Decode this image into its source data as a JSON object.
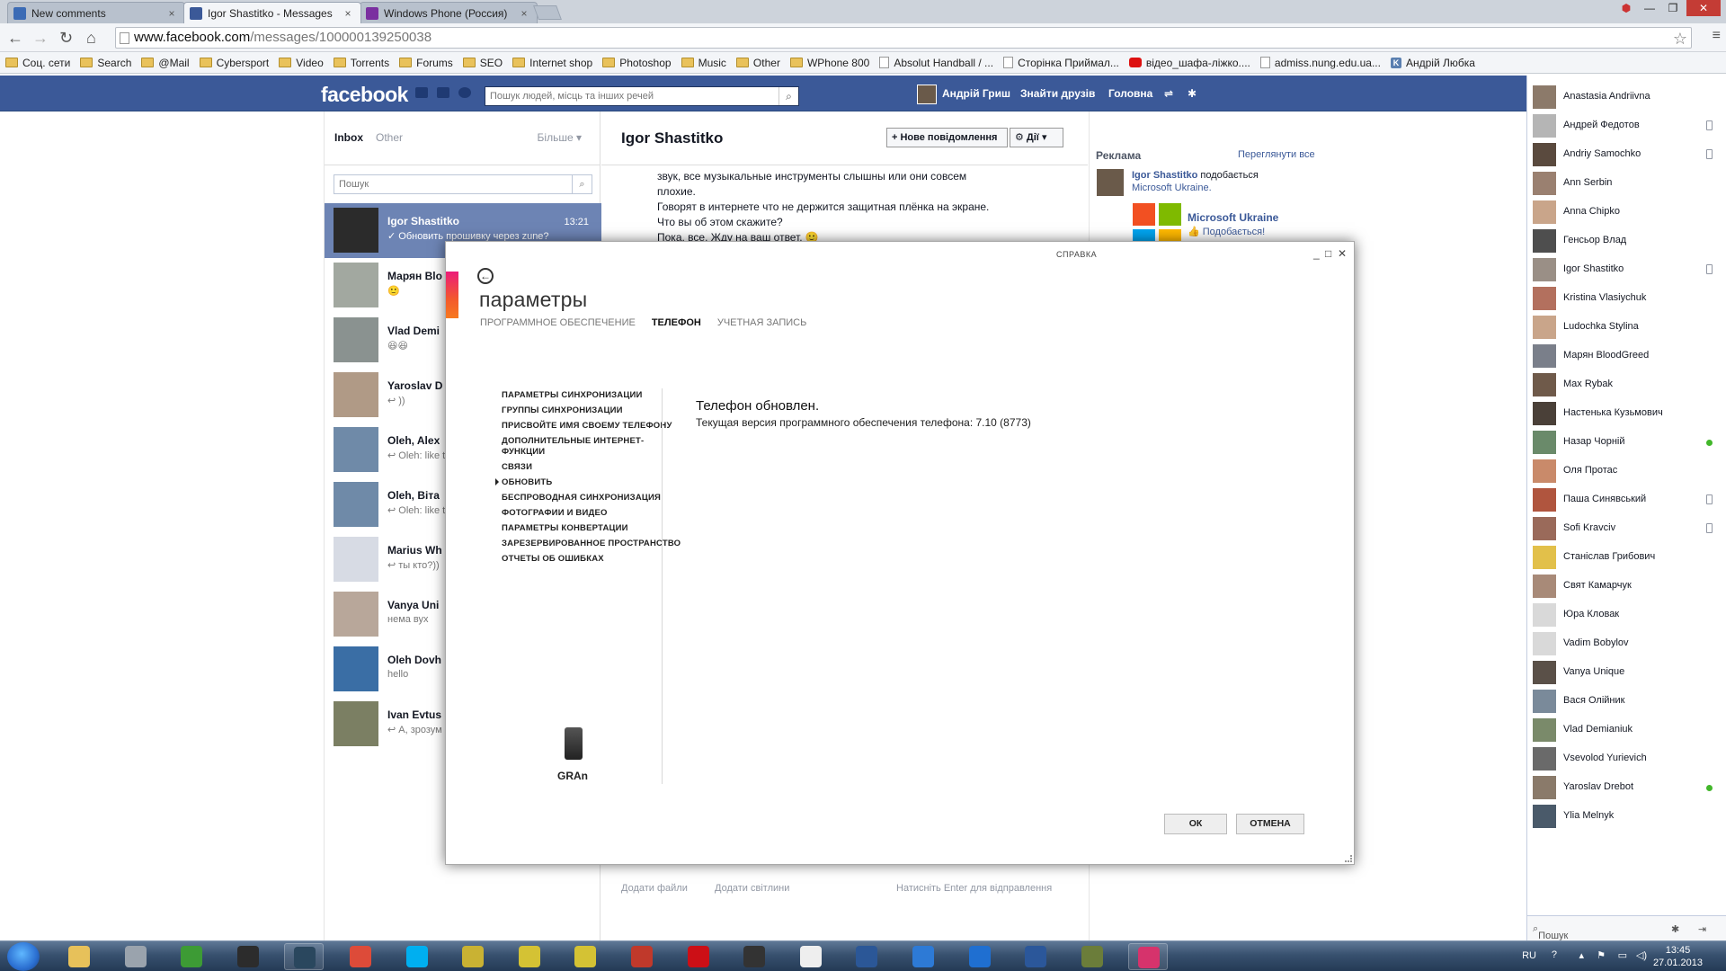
{
  "browser": {
    "tabs": [
      {
        "title": "New comments",
        "color": "#3b6bb5",
        "active": false
      },
      {
        "title": "Igor Shastitko - Messages",
        "color": "#3b5998",
        "active": true
      },
      {
        "title": "Windows Phone (Россия)",
        "color": "#7a2fa0",
        "active": false
      }
    ],
    "url_domain": "www.facebook.com",
    "url_path": "/messages/100000139250038",
    "bookmarks": [
      {
        "label": "Соц. сети",
        "type": "folder"
      },
      {
        "label": "Search",
        "type": "folder"
      },
      {
        "label": "@Mail",
        "type": "folder"
      },
      {
        "label": "Cybersport",
        "type": "folder"
      },
      {
        "label": "Video",
        "type": "folder"
      },
      {
        "label": "Torrents",
        "type": "folder"
      },
      {
        "label": "Forums",
        "type": "folder"
      },
      {
        "label": "SEO",
        "type": "folder"
      },
      {
        "label": "Internet shop",
        "type": "folder"
      },
      {
        "label": "Photoshop",
        "type": "folder"
      },
      {
        "label": "Music",
        "type": "folder"
      },
      {
        "label": "Other",
        "type": "folder"
      },
      {
        "label": "WPhone 800",
        "type": "folder"
      },
      {
        "label": "Absolut Handball / ...",
        "type": "page"
      },
      {
        "label": "Сторінка Приймал...",
        "type": "page"
      },
      {
        "label": "відео_шафа-ліжко....",
        "type": "youtube"
      },
      {
        "label": "admiss.nung.edu.ua...",
        "type": "page"
      },
      {
        "label": "Андрій Любка",
        "type": "k"
      }
    ]
  },
  "facebook": {
    "logo": "facebook",
    "search_placeholder": "Пошук людей, місць та інших речей",
    "user_name": "Андрій Гриш",
    "find_friends": "Знайти друзів",
    "home": "Головна",
    "inbox": {
      "title": "Inbox",
      "other": "Other",
      "more": "Більше ▾",
      "search_placeholder": "Пошук",
      "conversations": [
        {
          "name": "Igor Shastitko",
          "snippet": "✓ Обновить прошивку через zune?",
          "time": "13:21",
          "selected": true
        },
        {
          "name": "Марян Blo",
          "snippet": "🙂",
          "time": "",
          "selected": false
        },
        {
          "name": "Vlad Demi",
          "snippet": "😆😆",
          "time": "",
          "selected": false
        },
        {
          "name": "Yaroslav D",
          "snippet": "↩ ))",
          "time": "",
          "selected": false
        },
        {
          "name": "Oleh, Alex",
          "snippet": "↩ Oleh: like t",
          "time": "",
          "selected": false
        },
        {
          "name": "Oleh, Віта",
          "snippet": "↩ Oleh: like t",
          "time": "",
          "selected": false
        },
        {
          "name": "Marius Wh",
          "snippet": "↩ ты кто?))",
          "time": "",
          "selected": false
        },
        {
          "name": "Vanya Uni",
          "snippet": "нема вух",
          "time": "",
          "selected": false
        },
        {
          "name": "Oleh Dovh",
          "snippet": "hello",
          "time": "",
          "selected": false
        },
        {
          "name": "Ivan Evtus",
          "snippet": "↩ А, зрозум",
          "time": "",
          "selected": false
        }
      ]
    },
    "thread": {
      "name": "Igor Shastitko",
      "new_message": "+ Нове повідомлення",
      "actions": "⚙ Дії ▾",
      "messages": [
        "звук, все музыкальные инструменты слышны или они совсем",
        "плохие.",
        "Говорят в интернете что не держится защитная плёнка на экране.",
        "Что вы об этом скажите?",
        "Пока, все. Жду на ваш ответ. 🙂"
      ],
      "add_files": "Додати файли",
      "add_photos": "Додати світлини",
      "enter_hint": "Натисніть Enter для відправлення"
    },
    "ads": {
      "title": "Реклама",
      "see_all": "Переглянути все",
      "liker": "Igor Shastitko",
      "liker_text": "подобається",
      "liked_page": "Microsoft Ukraine.",
      "page_name": "Microsoft Ukraine",
      "like_label": "Подобається!"
    },
    "chat": {
      "friends": [
        {
          "name": "Anastasia Andriivna",
          "status": ""
        },
        {
          "name": "Андрей Федотов",
          "status": "mobile"
        },
        {
          "name": "Andriy Samochko",
          "status": "mobile"
        },
        {
          "name": "Ann Serbin",
          "status": ""
        },
        {
          "name": "Anna Chipko",
          "status": ""
        },
        {
          "name": "Генсьор Влад",
          "status": ""
        },
        {
          "name": "Igor Shastitko",
          "status": "mobile"
        },
        {
          "name": "Kristina Vlasiychuk",
          "status": ""
        },
        {
          "name": "Ludochka Stylina",
          "status": ""
        },
        {
          "name": "Марян BloodGreed",
          "status": ""
        },
        {
          "name": "Max Rybak",
          "status": ""
        },
        {
          "name": "Настенька Кузьмович",
          "status": ""
        },
        {
          "name": "Назар Чорній",
          "status": "online"
        },
        {
          "name": "Оля Протас",
          "status": ""
        },
        {
          "name": "Паша Синявський",
          "status": "mobile"
        },
        {
          "name": "Sofi Kravciv",
          "status": "mobile"
        },
        {
          "name": "Станіслав Грибович",
          "status": ""
        },
        {
          "name": "Свят Камарчук",
          "status": ""
        },
        {
          "name": "Юра Кловак",
          "status": ""
        },
        {
          "name": "Vadim Bobylov",
          "status": ""
        },
        {
          "name": "Vanya Unique",
          "status": ""
        },
        {
          "name": "Вася Олійник",
          "status": ""
        },
        {
          "name": "Vlad Demianiuk",
          "status": ""
        },
        {
          "name": "Vsevolod Yurievich",
          "status": ""
        },
        {
          "name": "Yaroslav Drebot",
          "status": "online"
        },
        {
          "name": "Ylia Melnyk",
          "status": ""
        }
      ],
      "search_placeholder": "Пошук"
    }
  },
  "zune": {
    "help": "СПРАВКА",
    "title": "параметры",
    "tabs": [
      {
        "label": "ПРОГРАММНОЕ ОБЕСПЕЧЕНИЕ",
        "active": false
      },
      {
        "label": "ТЕЛЕФОН",
        "active": true
      },
      {
        "label": "УЧЕТНАЯ ЗАПИСЬ",
        "active": false
      }
    ],
    "menu": [
      {
        "label": "ПАРАМЕТРЫ СИНХРОНИЗАЦИИ",
        "current": false
      },
      {
        "label": "ГРУППЫ СИНХРОНИЗАЦИИ",
        "current": false
      },
      {
        "label": "ПРИСВОЙТЕ ИМЯ СВОЕМУ ТЕЛЕФОНУ",
        "current": false
      },
      {
        "label": "ДОПОЛНИТЕЛЬНЫЕ ИНТЕРНЕТ-ФУНКЦИИ",
        "current": false
      },
      {
        "label": "СВЯЗИ",
        "current": false
      },
      {
        "label": "ОБНОВИТЬ",
        "current": true
      },
      {
        "label": "БЕСПРОВОДНАЯ СИНХРОНИЗАЦИЯ",
        "current": false
      },
      {
        "label": "ФОТОГРАФИИ И ВИДЕО",
        "current": false
      },
      {
        "label": "ПАРАМЕТРЫ КОНВЕРТАЦИИ",
        "current": false
      },
      {
        "label": "ЗАРЕЗЕРВИРОВАННОЕ ПРОСТРАНСТВО",
        "current": false
      },
      {
        "label": "ОТЧЕТЫ ОБ ОШИБКАХ",
        "current": false
      }
    ],
    "phone_name": "GRAn",
    "status": "Телефон обновлен.",
    "version_text": "Текущая версия программного обеспечения телефона: 7.10 (8773)",
    "ok": "ОК",
    "cancel": "ОТМЕНА"
  },
  "taskbar": {
    "apps": [
      {
        "icon": "explorer-icon",
        "color": "#e7c15a"
      },
      {
        "icon": "media-icon",
        "color": "#9aa3ad"
      },
      {
        "icon": "utorrent-icon",
        "color": "#3d9b35"
      },
      {
        "icon": "winamp-icon",
        "color": "#2c2c2c"
      },
      {
        "icon": "steam-icon",
        "color": "#2a475e"
      },
      {
        "icon": "chrome-icon",
        "color": "#dd4b39"
      },
      {
        "icon": "skype-icon",
        "color": "#00aff0"
      },
      {
        "icon": "game-icon",
        "color": "#c9b233"
      },
      {
        "icon": "totalcmd-icon",
        "color": "#d4c234"
      },
      {
        "icon": "totalcmd2-icon",
        "color": "#d4c234"
      },
      {
        "icon": "mobile-icon",
        "color": "#c0392b"
      },
      {
        "icon": "opera-icon",
        "color": "#cc0f16"
      },
      {
        "icon": "console-icon",
        "color": "#333333"
      },
      {
        "icon": "inkscape-icon",
        "color": "#eeeeee"
      },
      {
        "icon": "photoshop-icon",
        "color": "#2b5797"
      },
      {
        "icon": "ccleaner-icon",
        "color": "#2d7ad6"
      },
      {
        "icon": "zune-launcher-icon",
        "color": "#1f6fd1"
      },
      {
        "icon": "word-icon",
        "color": "#2b579a"
      },
      {
        "icon": "tank-icon",
        "color": "#6b7d3a"
      },
      {
        "icon": "zune-icon",
        "color": "#d6336c"
      }
    ],
    "lang": "RU",
    "time": "13:45",
    "date": "27.01.2013"
  }
}
